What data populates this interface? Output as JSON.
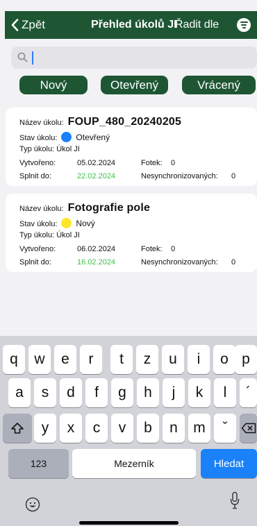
{
  "header": {
    "back_label": "Zpět",
    "title": "Přehled úkolů JI",
    "sort_label": "Řadit dle"
  },
  "search": {
    "value": "",
    "placeholder": ""
  },
  "filters": [
    {
      "label": "Nový"
    },
    {
      "label": "Otevřený"
    },
    {
      "label": "Vrácený"
    }
  ],
  "labels": {
    "name": "Název úkolu:",
    "state": "Stav úkolu:",
    "type": "Typ úkolu:",
    "created": "Vytvořeno:",
    "due": "Splnit do:",
    "photos": "Fotek:",
    "unsynced": "Nesynchronizovaných:"
  },
  "tasks": [
    {
      "name": "FOUP_480_20240205",
      "state": "Otevřený",
      "state_color": "#1a81f8",
      "type": "Úkol JI",
      "created": "05.02.2024",
      "due": "22.02.2024",
      "photos": "0",
      "unsynced": "0"
    },
    {
      "name": "Fotografie pole",
      "state": "Nový",
      "state_color": "#ffe52a",
      "type": "Úkol JI",
      "created": "06.02.2024",
      "due": "16.02.2024",
      "photos": "0",
      "unsynced": "0"
    }
  ],
  "colors": {
    "brand_green": "#1e5634",
    "due_green": "#3cc24a",
    "key_blue": "#1a81f8"
  },
  "keyboard": {
    "row1": [
      "q",
      "w",
      "e",
      "r",
      "t",
      "z",
      "u",
      "i",
      "o",
      "p"
    ],
    "row2": [
      "a",
      "s",
      "d",
      "f",
      "g",
      "h",
      "j",
      "k",
      "l",
      "´"
    ],
    "row3": [
      "y",
      "x",
      "c",
      "v",
      "b",
      "n",
      "m",
      "ˇ"
    ],
    "numbers_label": "123",
    "space_label": "Mezerník",
    "search_label": "Hledat",
    "shift_icon": "shift-icon",
    "delete_icon": "delete-icon",
    "emoji_icon": "emoji-icon",
    "mic_icon": "microphone-icon"
  }
}
